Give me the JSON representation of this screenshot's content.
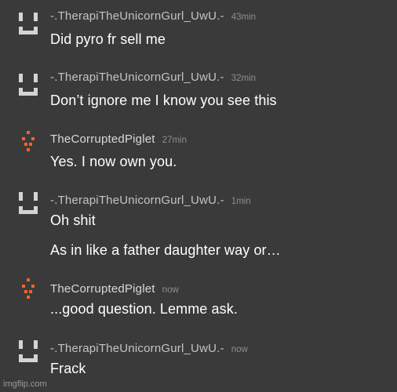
{
  "messages": [
    {
      "avatar": "gray-sad-face-icon",
      "username": "-.TherapiTheUnicornGurl_UwU.-",
      "time": "43min",
      "lines": [
        "Did pyro fr sell me"
      ]
    },
    {
      "avatar": "gray-sad-face-icon",
      "username": "-.TherapiTheUnicornGurl_UwU.-",
      "time": "32min",
      "lines": [
        "Don’t ignore me I know you see this"
      ]
    },
    {
      "avatar": "orange-face-icon",
      "username": "TheCorruptedPiglet",
      "time": "27min",
      "lines": [
        "Yes. I now own you."
      ]
    },
    {
      "avatar": "gray-sad-face-icon",
      "username": "-.TherapiTheUnicornGurl_UwU.-",
      "time": "1min",
      "lines": [
        "Oh shit",
        "As in like a father daughter way or…"
      ]
    },
    {
      "avatar": "orange-face-icon",
      "username": "TheCorruptedPiglet",
      "time": "now",
      "lines": [
        "...good question. Lemme ask."
      ]
    },
    {
      "avatar": "gray-sad-face-icon",
      "username": "-.TherapiTheUnicornGurl_UwU.-",
      "time": "now",
      "lines": [
        "Frack"
      ]
    }
  ],
  "watermark": "imgflip.com",
  "colors": {
    "background": "#3a3a3a",
    "gray_avatar": "#d4d4d4",
    "orange_avatar": "#f26522"
  }
}
